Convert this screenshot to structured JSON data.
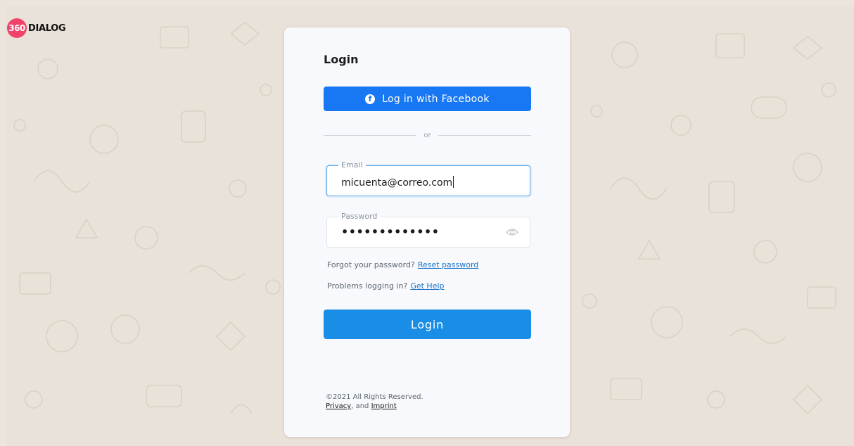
{
  "brand": {
    "mark_text": "360",
    "name": "DIALOG",
    "mark_color": "#f0436a"
  },
  "login": {
    "title": "Login",
    "facebook_button": "Log in with Facebook",
    "facebook_icon": "facebook-icon",
    "divider_text": "or",
    "email": {
      "label": "Email",
      "value": "micuenta@correo.com"
    },
    "password": {
      "label": "Password",
      "masked_value": "•••••••••••••",
      "toggle_icon": "eye-icon"
    },
    "forgot": {
      "prompt": "Forgot your password?",
      "link": "Reset password"
    },
    "problems": {
      "prompt": "Problems logging in?",
      "link": "Get Help"
    },
    "submit": "Login"
  },
  "footer": {
    "copyright": "©2021 All Rights Reserved.",
    "privacy": "Privacy",
    "separator": ", and",
    "imprint": "Imprint"
  },
  "colors": {
    "background": "#e9e2d9",
    "facebook_blue": "#1877f2",
    "primary_blue": "#1a8ee6",
    "link_blue": "#1f73c8"
  }
}
